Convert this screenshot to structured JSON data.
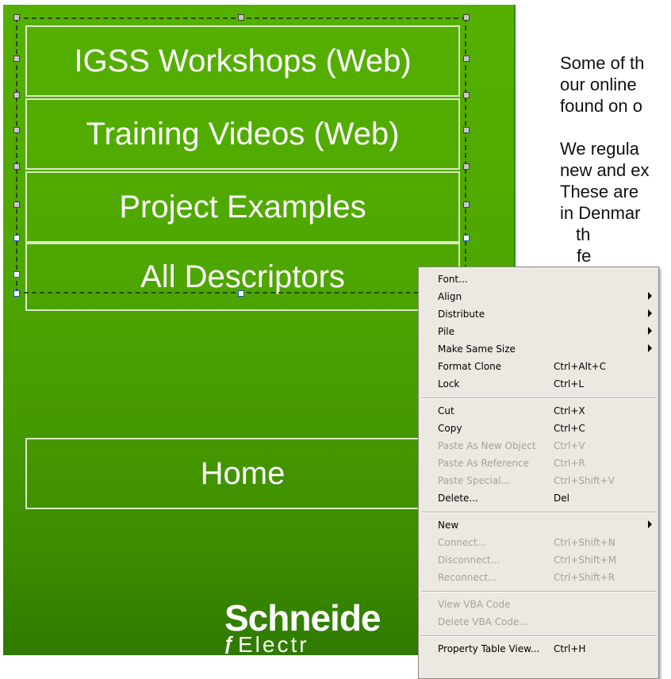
{
  "nav": {
    "workshops": "IGSS Workshops (Web)",
    "videos": "Training Videos (Web)",
    "examples": "Project Examples",
    "descriptors": "All Descriptors",
    "home": "Home"
  },
  "logo": {
    "main": "Schneide",
    "sub": "Electr"
  },
  "right_text": {
    "lines": [
      "Some of th",
      "our online",
      "found on o",
      "",
      "We regula",
      "new and ex",
      "These are",
      "in Denmar",
      "th",
      "fe"
    ]
  },
  "context_menu": {
    "items": [
      {
        "label": "Font...",
        "shortcut": "",
        "submenu": false,
        "disabled": false
      },
      {
        "label": "Align",
        "shortcut": "",
        "submenu": true,
        "disabled": false
      },
      {
        "label": "Distribute",
        "shortcut": "",
        "submenu": true,
        "disabled": false
      },
      {
        "label": "Pile",
        "shortcut": "",
        "submenu": true,
        "disabled": false
      },
      {
        "label": "Make Same Size",
        "shortcut": "",
        "submenu": true,
        "disabled": false
      },
      {
        "label": "Format Clone",
        "shortcut": "Ctrl+Alt+C",
        "submenu": false,
        "disabled": false
      },
      {
        "label": "Lock",
        "shortcut": "Ctrl+L",
        "submenu": false,
        "disabled": false
      },
      {
        "label": "Cut",
        "shortcut": "Ctrl+X",
        "submenu": false,
        "disabled": false
      },
      {
        "label": "Copy",
        "shortcut": "Ctrl+C",
        "submenu": false,
        "disabled": false
      },
      {
        "label": "Paste As New Object",
        "shortcut": "Ctrl+V",
        "submenu": false,
        "disabled": true
      },
      {
        "label": "Paste As Reference",
        "shortcut": "Ctrl+R",
        "submenu": false,
        "disabled": true
      },
      {
        "label": "Paste Special...",
        "shortcut": "Ctrl+Shift+V",
        "submenu": false,
        "disabled": true
      },
      {
        "label": "Delete...",
        "shortcut": "Del",
        "submenu": false,
        "disabled": false
      },
      {
        "label": "New",
        "shortcut": "",
        "submenu": true,
        "disabled": false
      },
      {
        "label": "Connect...",
        "shortcut": "Ctrl+Shift+N",
        "submenu": false,
        "disabled": true
      },
      {
        "label": "Disconnect...",
        "shortcut": "Ctrl+Shift+M",
        "submenu": false,
        "disabled": true
      },
      {
        "label": "Reconnect...",
        "shortcut": "Ctrl+Shift+R",
        "submenu": false,
        "disabled": true
      },
      {
        "label": "View VBA Code",
        "shortcut": "",
        "submenu": false,
        "disabled": true
      },
      {
        "label": "Delete VBA Code...",
        "shortcut": "",
        "submenu": false,
        "disabled": true
      },
      {
        "label": "Property Table View...",
        "shortcut": "Ctrl+H",
        "submenu": false,
        "disabled": false
      }
    ]
  },
  "colors": {
    "panel_green": "#4ea700",
    "menu_bg": "#ece9e2",
    "disabled_text": "#a6a39c"
  }
}
